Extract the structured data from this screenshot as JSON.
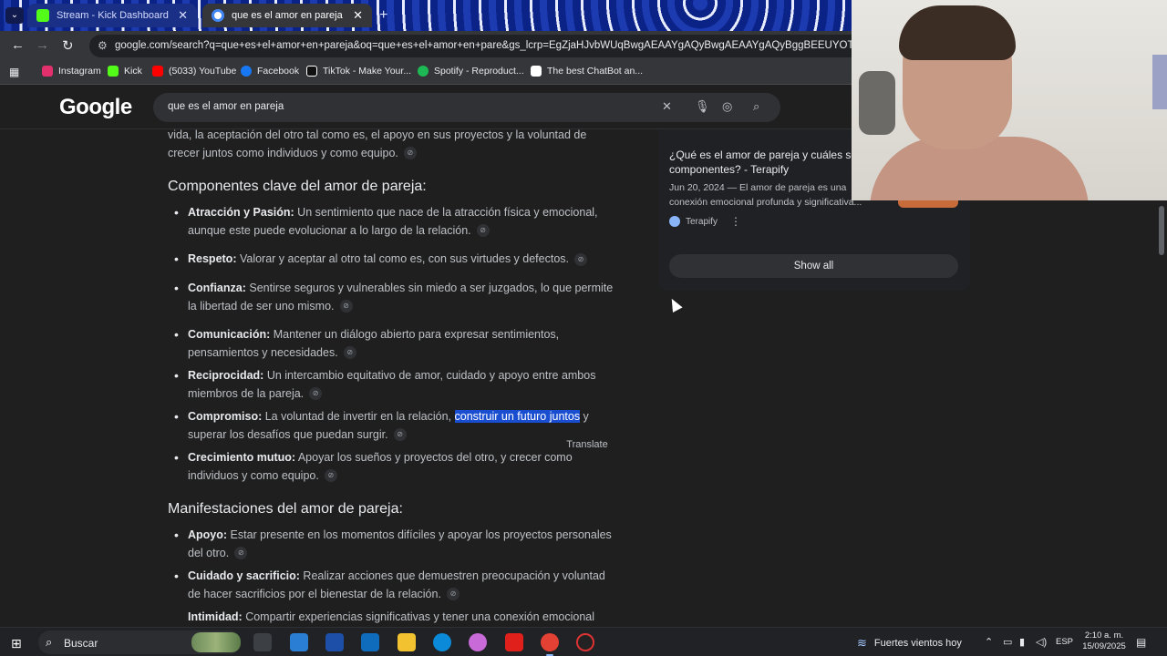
{
  "browser": {
    "tabs": [
      {
        "title": "Stream - Kick Dashboard",
        "favicon_color": "#53fc18"
      },
      {
        "title": "que es el amor en pareja - Goo",
        "favicon_color": "#4285f4"
      }
    ],
    "new_tab_label": "+",
    "url": "google.com/search?q=que+es+el+amor+en+pareja&oq=que+es+el+amor+en+pare&gs_lcrp=EgZjaHJvbWUqBwgAEAAYgAQyBwgAEAAYgAQyBggBEEUYOTIICAIQ",
    "bookmarks": [
      {
        "label": "Instagram",
        "color": "#e1306c"
      },
      {
        "label": "Kick",
        "color": "#53fc18"
      },
      {
        "label": "(5033) YouTube",
        "color": "#ff0000"
      },
      {
        "label": "Facebook",
        "color": "#1877f2"
      },
      {
        "label": "TikTok - Make Your...",
        "color": "#ffffff"
      },
      {
        "label": "Spotify - Reproduct...",
        "color": "#1db954"
      },
      {
        "label": "The best ChatBot an...",
        "color": "#ffffff"
      }
    ]
  },
  "google": {
    "logo": "Google",
    "query": "que es el amor en pareja"
  },
  "content": {
    "intro_line1": "vida, la aceptación del otro tal como es, el apoyo en sus proyectos y la voluntad de",
    "intro_line2": "crecer juntos como individuos y como equipo.",
    "section1_title": "Componentes clave del amor de pareja:",
    "components": [
      {
        "term": "Atracción y Pasión:",
        "l1": " Un sentimiento que nace de la atracción física y emocional,",
        "l2": "aunque este puede evolucionar a lo largo de la relación."
      },
      {
        "term": "Respeto:",
        "l1": " Valorar y aceptar al otro tal como es, con sus virtudes y defectos.",
        "l2": ""
      },
      {
        "term": "Confianza:",
        "l1": " Sentirse seguros y vulnerables sin miedo a ser juzgados, lo que permite",
        "l2": "la libertad de ser uno mismo."
      },
      {
        "term": "Comunicación:",
        "l1": " Mantener un diálogo abierto para expresar sentimientos,",
        "l2": "pensamientos y necesidades."
      },
      {
        "term": "Reciprocidad:",
        "l1": " Un intercambio equitativo de amor, cuidado y apoyo entre ambos",
        "l2": "miembros de la pareja."
      },
      {
        "term": "Compromiso:",
        "l1a": " La voluntad de invertir en la relación, ",
        "l1hl": "construir un futuro juntos",
        "l1b": " y",
        "l2": "superar los desafíos que puedan surgir."
      },
      {
        "term": "Crecimiento mutuo:",
        "l1": " Apoyar los sueños y proyectos del otro, y crecer como",
        "l2": "individuos y como equipo."
      }
    ],
    "translate_tooltip": "Translate",
    "section2_title": "Manifestaciones del amor de pareja:",
    "manifestations": [
      {
        "term": "Apoyo:",
        "l1": " Estar presente en los momentos difíciles y apoyar los proyectos personales",
        "l2": "del otro."
      },
      {
        "term": "Cuidado y sacrificio:",
        "l1": " Realizar acciones que demuestren preocupación y voluntad",
        "l2": "de hacer sacrificios por el bienestar de la relación."
      },
      {
        "term": "Intimidad:",
        "l1": " Compartir experiencias significativas y tener una conexión emocional",
        "l2": ""
      }
    ]
  },
  "side_panel": {
    "title": "¿Qué es el amor de pareja y cuáles son sus componentes? - Terapify",
    "snippet": "Jun 20, 2024 — El amor de pareja es una conexión emocional profunda y significativa...",
    "source": "Terapify",
    "show_all": "Show all"
  },
  "taskbar": {
    "search_label": "Buscar",
    "weather": "Fuertes vientos hoy",
    "language": "ESP",
    "time": "2:10 a. m.",
    "date": "15/09/2025"
  }
}
